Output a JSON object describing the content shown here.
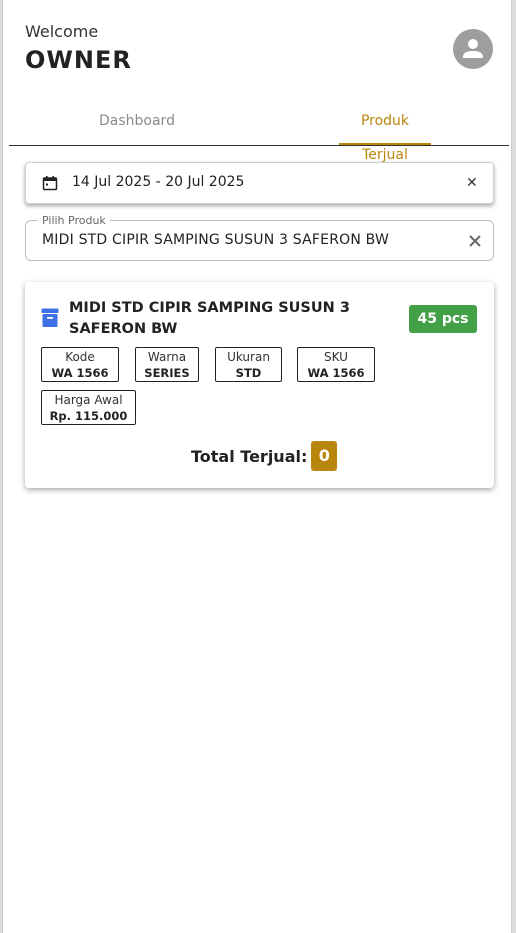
{
  "header": {
    "welcome": "Welcome",
    "user_role": "OWNER",
    "avatar_icon": "account-circle-icon"
  },
  "tabs": [
    {
      "label": "Dashboard",
      "active": false
    },
    {
      "label": "Produk Terjual",
      "active": true
    }
  ],
  "date_filter": {
    "icon": "calendar-icon",
    "value": "14 Jul 2025 - 20 Jul 2025",
    "clear_icon": "close-icon"
  },
  "product_select": {
    "label": "Pilih Produk",
    "value": "MIDI STD CIPIR SAMPING SUSUN 3 SAFERON BW",
    "clear_icon": "close-icon"
  },
  "product_card": {
    "icon": "archive-box-icon",
    "name": "MIDI STD CIPIR SAMPING SUSUN 3 SAFERON BW",
    "stock": "45 pcs",
    "chips": [
      {
        "label": "Kode",
        "value": "WA 1566"
      },
      {
        "label": "Warna",
        "value": "SERIES"
      },
      {
        "label": "Ukuran",
        "value": "STD"
      },
      {
        "label": "SKU",
        "value": "WA 1566"
      },
      {
        "label": "Harga Awal",
        "value": "Rp. 115.000"
      }
    ],
    "total_label": "Total Terjual:",
    "total_value": "0"
  },
  "colors": {
    "accent": "#b8860b",
    "stock_badge": "#43a047",
    "card_icon": "#3f6fe6"
  }
}
